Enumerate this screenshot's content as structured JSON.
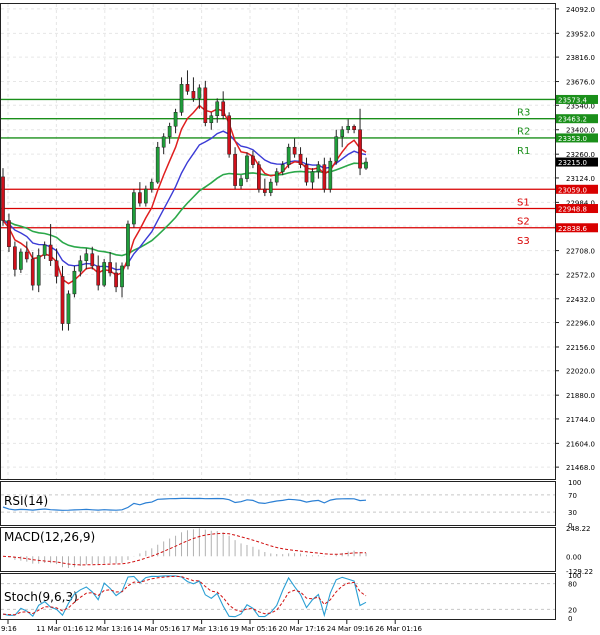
{
  "chart_data": {
    "type": "candlestick",
    "title": "",
    "price_axis": {
      "ylim": [
        21400,
        24120
      ],
      "ticks": [
        "24092.0",
        "23952.0",
        "23816.0",
        "23676.0",
        "23540.0",
        "23400.0",
        "23260.0",
        "23124.0",
        "22984.0",
        "22848.0",
        "22708.0",
        "22572.0",
        "22432.0",
        "22296.0",
        "22156.0",
        "22020.0",
        "21880.0",
        "21744.0",
        "21604.0",
        "21468.0"
      ]
    },
    "time_axis": {
      "labels": [
        "9:16",
        "11 Mar 01:16",
        "12 Mar 13:16",
        "14 Mar 05:16",
        "17 Mar 13:16",
        "19 Mar 05:16",
        "20 Mar 17:16",
        "24 Mar 09:16",
        "26 Mar 01:16"
      ]
    },
    "levels": [
      {
        "name": "R3",
        "value": 23573.4,
        "label": "23573.4"
      },
      {
        "name": "R2",
        "value": 23463.2,
        "label": "23463.2"
      },
      {
        "name": "R1",
        "value": 23353.0,
        "label": "23353.0"
      },
      {
        "name": "S1",
        "value": 23059.0,
        "label": "23059.0"
      },
      {
        "name": "S2",
        "value": 22948.8,
        "label": "22948.8"
      },
      {
        "name": "S3",
        "value": 22838.6,
        "label": "22838.6"
      }
    ],
    "last_price": {
      "value": 23215.0,
      "label": "23215.0"
    },
    "candles": [
      [
        23130,
        23180,
        22850,
        22880
      ],
      [
        22880,
        22920,
        22700,
        22730
      ],
      [
        22730,
        22760,
        22560,
        22600
      ],
      [
        22600,
        22720,
        22580,
        22700
      ],
      [
        22700,
        22760,
        22640,
        22660
      ],
      [
        22660,
        22700,
        22480,
        22510
      ],
      [
        22510,
        22720,
        22470,
        22680
      ],
      [
        22680,
        22760,
        22660,
        22740
      ],
      [
        22740,
        22860,
        22620,
        22650
      ],
      [
        22650,
        22720,
        22520,
        22560
      ],
      [
        22560,
        22620,
        22250,
        22290
      ],
      [
        22290,
        22480,
        22250,
        22460
      ],
      [
        22460,
        22620,
        22440,
        22590
      ],
      [
        22590,
        22680,
        22560,
        22650
      ],
      [
        22650,
        22720,
        22600,
        22690
      ],
      [
        22690,
        22730,
        22600,
        22620
      ],
      [
        22620,
        22680,
        22480,
        22510
      ],
      [
        22510,
        22660,
        22500,
        22640
      ],
      [
        22640,
        22700,
        22560,
        22580
      ],
      [
        22580,
        22640,
        22470,
        22500
      ],
      [
        22500,
        22640,
        22440,
        22620
      ],
      [
        22620,
        22880,
        22600,
        22860
      ],
      [
        22860,
        23060,
        22840,
        23040
      ],
      [
        23040,
        23100,
        22960,
        22980
      ],
      [
        22980,
        23080,
        22960,
        23060
      ],
      [
        23060,
        23120,
        23040,
        23100
      ],
      [
        23100,
        23330,
        23090,
        23300
      ],
      [
        23300,
        23380,
        23260,
        23360
      ],
      [
        23360,
        23440,
        23320,
        23420
      ],
      [
        23420,
        23520,
        23380,
        23500
      ],
      [
        23500,
        23700,
        23480,
        23660
      ],
      [
        23660,
        23740,
        23600,
        23620
      ],
      [
        23620,
        23700,
        23560,
        23580
      ],
      [
        23580,
        23660,
        23520,
        23640
      ],
      [
        23640,
        23680,
        23420,
        23440
      ],
      [
        23440,
        23500,
        23400,
        23480
      ],
      [
        23480,
        23580,
        23440,
        23560
      ],
      [
        23560,
        23620,
        23460,
        23480
      ],
      [
        23480,
        23500,
        23240,
        23260
      ],
      [
        23260,
        23300,
        23060,
        23080
      ],
      [
        23080,
        23140,
        23060,
        23120
      ],
      [
        23120,
        23270,
        23100,
        23250
      ],
      [
        23250,
        23280,
        23180,
        23200
      ],
      [
        23200,
        23220,
        23040,
        23060
      ],
      [
        23060,
        23120,
        23020,
        23040
      ],
      [
        23040,
        23120,
        23020,
        23100
      ],
      [
        23100,
        23180,
        23080,
        23160
      ],
      [
        23160,
        23220,
        23140,
        23200
      ],
      [
        23200,
        23320,
        23180,
        23300
      ],
      [
        23300,
        23350,
        23240,
        23260
      ],
      [
        23260,
        23300,
        23180,
        23200
      ],
      [
        23200,
        23240,
        23080,
        23100
      ],
      [
        23100,
        23180,
        23060,
        23160
      ],
      [
        23160,
        23220,
        23120,
        23200
      ],
      [
        23200,
        23240,
        23040,
        23060
      ],
      [
        23060,
        23240,
        23040,
        23220
      ],
      [
        23220,
        23400,
        23200,
        23360
      ],
      [
        23360,
        23420,
        23300,
        23400
      ],
      [
        23400,
        23460,
        23380,
        23420
      ],
      [
        23420,
        23430,
        23380,
        23400
      ],
      [
        23400,
        23520,
        23140,
        23180
      ],
      [
        23180,
        23240,
        23170,
        23215
      ]
    ],
    "ma_red_period": "fast",
    "indicators": [
      {
        "name": "RSI(14)",
        "label": "RSI(14)",
        "ticks": [
          "100",
          "70",
          "30",
          "0"
        ],
        "levels": [
          70,
          30
        ],
        "last": 58
      },
      {
        "name": "MACD(12,26,9)",
        "label": "MACD(12,26,9)",
        "ticks": [
          "248.22",
          "0.00",
          "-129.22"
        ]
      },
      {
        "name": "Stoch(9,6,3)",
        "label": "Stoch(9,6,3)",
        "ticks": [
          "100",
          "80",
          "20",
          "0"
        ],
        "levels": [
          80,
          20
        ]
      }
    ]
  }
}
